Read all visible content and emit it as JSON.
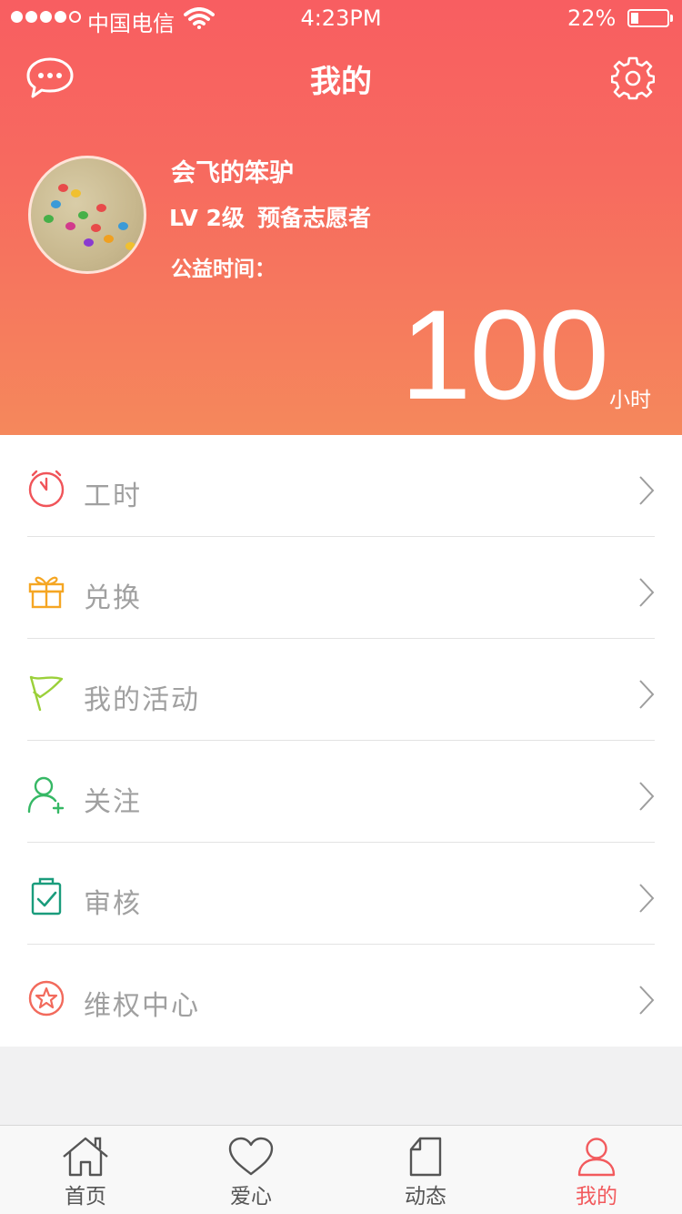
{
  "status_bar": {
    "carrier": "中国电信",
    "time": "4:23PM",
    "battery_percent": "22%"
  },
  "header": {
    "title": "我的",
    "left_icon": "chat-bubble-icon",
    "right_icon": "gear-icon"
  },
  "profile": {
    "name": "会飞的笨驴",
    "level": "LV 2级",
    "role": "预备志愿者",
    "time_label": "公益时间：",
    "hours_value": "100",
    "hours_unit": "小时"
  },
  "menu": {
    "items": [
      {
        "label": "工时",
        "icon": "clock-icon",
        "color": "#f05459"
      },
      {
        "label": "兑换",
        "icon": "gift-icon",
        "color": "#f5a623"
      },
      {
        "label": "我的活动",
        "icon": "flag-icon",
        "color": "#9bd03a"
      },
      {
        "label": "关注",
        "icon": "add-user-icon",
        "color": "#36b865"
      },
      {
        "label": "审核",
        "icon": "clipboard-check-icon",
        "color": "#1a9c7c"
      },
      {
        "label": "维权中心",
        "icon": "star-badge-icon",
        "color": "#f26a5c"
      }
    ]
  },
  "tabbar": {
    "tabs": [
      {
        "label": "首页",
        "icon": "home-icon"
      },
      {
        "label": "爱心",
        "icon": "heart-icon"
      },
      {
        "label": "动态",
        "icon": "document-icon"
      },
      {
        "label": "我的",
        "icon": "person-icon",
        "active": true
      }
    ],
    "active_color": "#f25a5d"
  }
}
